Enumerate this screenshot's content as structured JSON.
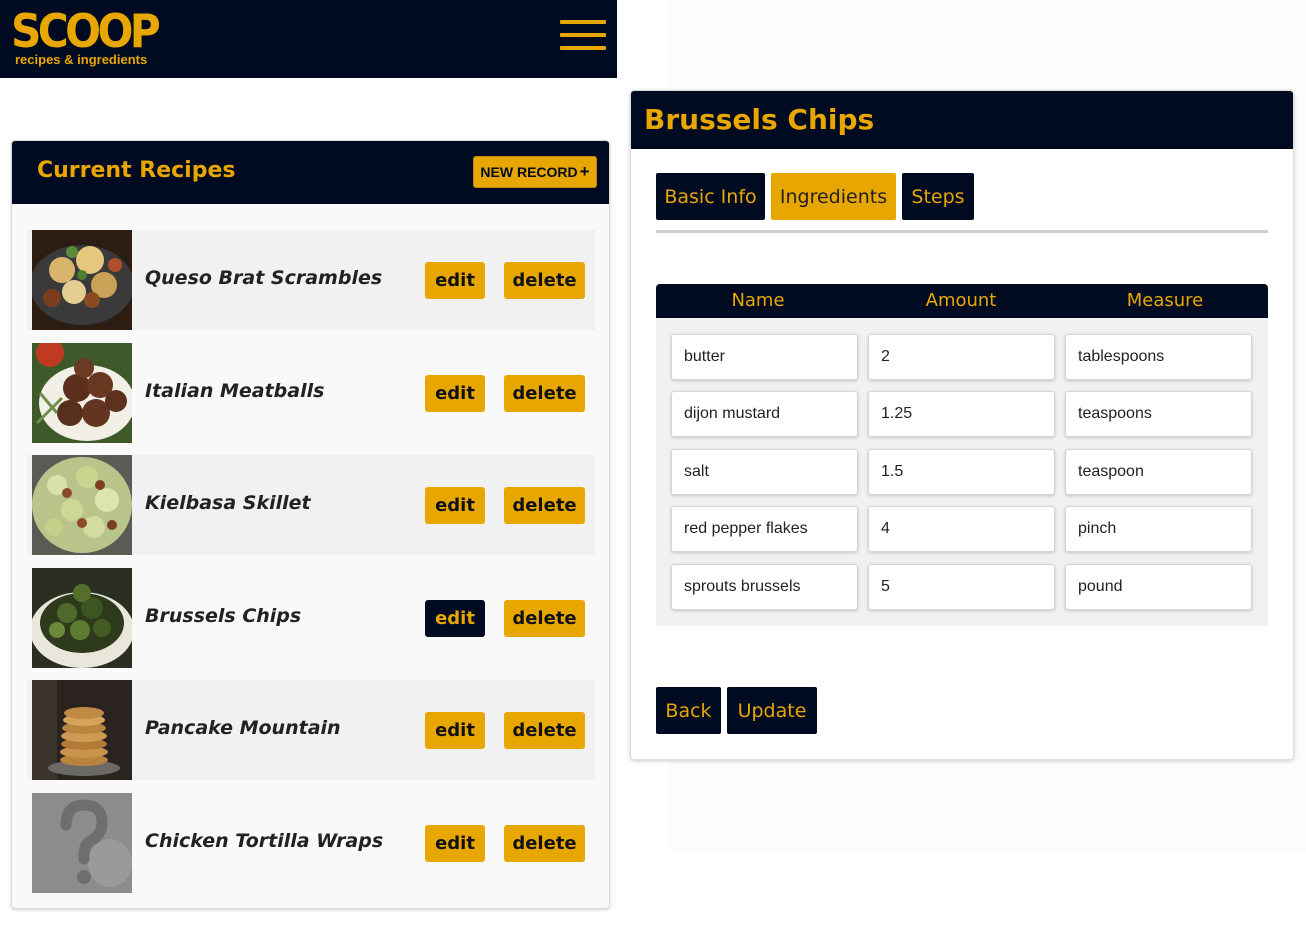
{
  "app": {
    "logo": "SCOOP",
    "tagline": "recipes & ingredients"
  },
  "recipes_panel": {
    "title": "Current Recipes",
    "new_record_label": "NEW RECORD",
    "new_record_icon": "plus-icon",
    "edit_label": "edit",
    "delete_label": "delete",
    "items": [
      {
        "name": "Queso Brat Scrambles"
      },
      {
        "name": "Italian Meatballs"
      },
      {
        "name": "Kielbasa Skillet"
      },
      {
        "name": "Brussels Chips"
      },
      {
        "name": "Pancake Mountain"
      },
      {
        "name": "Chicken Tortilla Wraps"
      }
    ],
    "active_item": "Brussels Chips"
  },
  "editor": {
    "title": "Brussels Chips",
    "tabs": [
      {
        "label": "Basic Info",
        "active": false
      },
      {
        "label": "Ingredients",
        "active": true
      },
      {
        "label": "Steps",
        "active": false
      }
    ],
    "columns": [
      "Name",
      "Amount",
      "Measure"
    ],
    "ingredients": [
      {
        "name": "butter",
        "amount": "2",
        "measure": "tablespoons"
      },
      {
        "name": "dijon mustard",
        "amount": "1.25",
        "measure": "teaspoons"
      },
      {
        "name": "salt",
        "amount": "1.5",
        "measure": "teaspoon"
      },
      {
        "name": "red pepper flakes",
        "amount": "4",
        "measure": "pinch"
      },
      {
        "name": "sprouts brussels",
        "amount": "5",
        "measure": "pound"
      }
    ],
    "back_label": "Back",
    "update_label": "Update"
  },
  "colors": {
    "navy": "#000b21",
    "gold": "#e8a600"
  }
}
